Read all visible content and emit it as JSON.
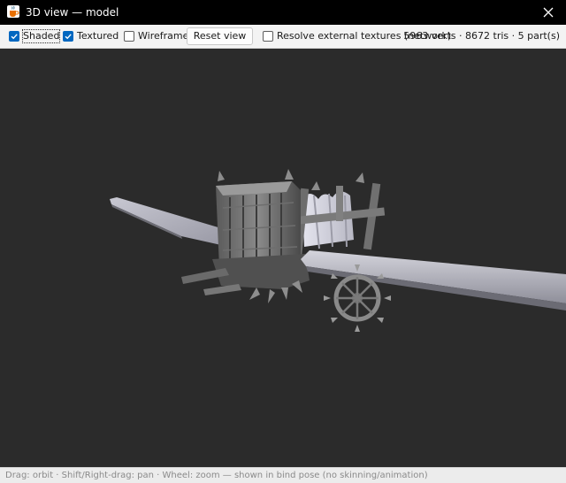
{
  "window": {
    "title": "3D view — model",
    "app_icon": "java-cup-icon",
    "close_icon": "close-icon"
  },
  "toolbar": {
    "shaded": {
      "label": "Shaded",
      "checked": true
    },
    "textured": {
      "label": "Textured",
      "checked": true
    },
    "wireframe": {
      "label": "Wireframe",
      "checked": false
    },
    "reset_view_label": "Reset view",
    "resolve_textures": {
      "label": "Resolve external textures (network)",
      "checked": false
    },
    "stats": "5963 verts · 8672 tris · 5 part(s)"
  },
  "statusbar": {
    "text": "Drag: orbit · Shift/Right-drag: pan · Wheel: zoom — shown in bind pose (no skinning/animation)"
  },
  "colors": {
    "titlebar_bg": "#000000",
    "viewport_bg": "#2b2b2b",
    "checkbox_accent": "#0067c0"
  }
}
